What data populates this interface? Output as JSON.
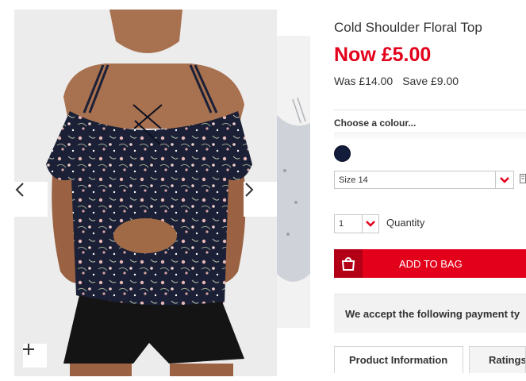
{
  "product": {
    "title": "Cold Shoulder Floral Top",
    "now_price": "Now £5.00",
    "was_price": "Was £14.00",
    "saving": "Save £9.00"
  },
  "colour": {
    "label": "Choose a colour...",
    "selected_swatch": "#141c3c"
  },
  "size": {
    "value": "Size 14"
  },
  "quantity": {
    "value": "1",
    "label": "Quantity"
  },
  "cart": {
    "button_label": "ADD TO BAG"
  },
  "payment": {
    "text": "We accept the following payment ty"
  },
  "tabs": [
    {
      "label": "Product Information"
    },
    {
      "label": "Ratings"
    }
  ],
  "icons": {
    "prev": "chevron-left-icon",
    "next": "chevron-right-icon",
    "zoom": "plus-icon",
    "bag": "shopping-bag-icon",
    "dropdown": "chevron-down-icon"
  },
  "colors": {
    "accent_red": "#e3001b",
    "dark_red": "#b30016"
  }
}
